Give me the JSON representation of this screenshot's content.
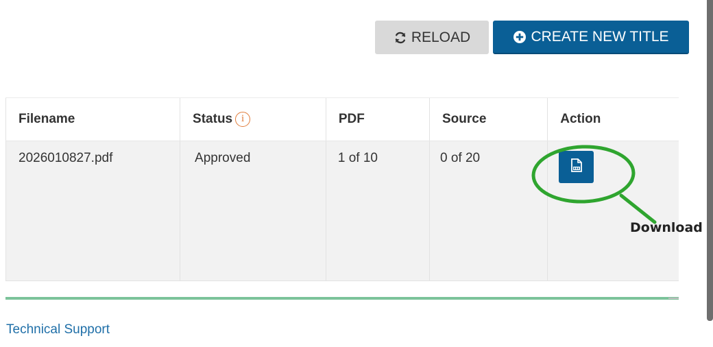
{
  "toolbar": {
    "reload_label": "RELOAD",
    "create_label": "CREATE NEW TITLE",
    "reload_icon": "refresh-icon",
    "create_icon": "plus-circle-icon"
  },
  "table": {
    "columns": [
      "Filename",
      "Status",
      "PDF",
      "Source",
      "Action"
    ],
    "status_info_glyph": "i",
    "rows": [
      {
        "filename": "2026010827.pdf",
        "status": "Approved",
        "pdf": "1 of 10",
        "source": "0 of 20",
        "action_icon": "pdf-file-icon"
      }
    ]
  },
  "annotation": {
    "label": "Download",
    "color": "#2fa52f"
  },
  "footer": {
    "support_link": "Technical Support"
  },
  "colors": {
    "primary": "#0a5f96",
    "reload_bg": "#d9d9d9",
    "info": "#e07b39",
    "divider": "#7cc39a",
    "link": "#1f6fa8"
  }
}
